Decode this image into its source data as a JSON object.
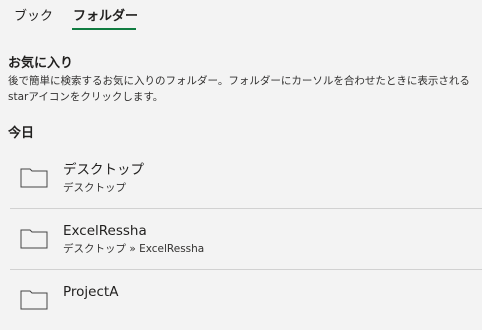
{
  "tabs": [
    {
      "label": "ブック",
      "active": false
    },
    {
      "label": "フォルダー",
      "active": true
    }
  ],
  "accent_color": "#107c41",
  "favorites": {
    "title": "お気に入り",
    "description": "後で簡単に検索するお気に入りのフォルダー。フォルダーにカーソルを合わせたときに表示されるstarアイコンをクリックします。"
  },
  "recent": {
    "group_title": "今日",
    "items": [
      {
        "name": "デスクトップ",
        "path": "デスクトップ",
        "icon": "folder-icon"
      },
      {
        "name": "ExcelRessha",
        "path": "デスクトップ » ExcelRessha",
        "icon": "folder-icon"
      },
      {
        "name": "ProjectA",
        "path": "",
        "icon": "folder-icon"
      }
    ]
  }
}
